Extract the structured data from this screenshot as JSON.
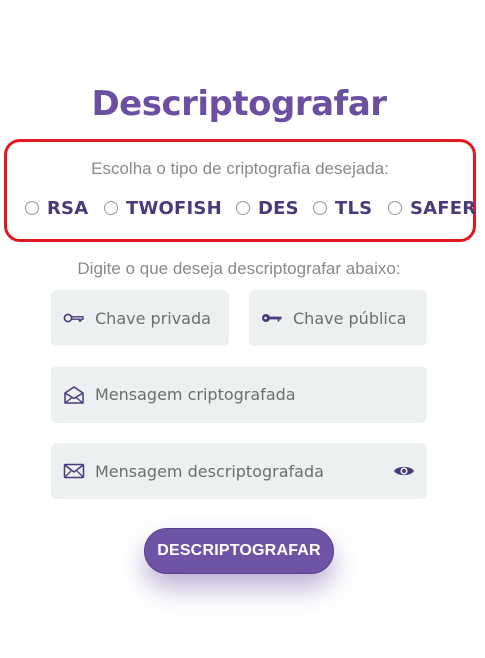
{
  "page": {
    "title": "Descriptografar",
    "choice_prompt": "Escolha o tipo de criptografia desejada:",
    "subtitle": "Digite o que deseja descriptografar abaixo:"
  },
  "algorithms": [
    {
      "label": "RSA",
      "selected": false
    },
    {
      "label": "TWOFISH",
      "selected": false
    },
    {
      "label": "DES",
      "selected": false
    },
    {
      "label": "TLS",
      "selected": false
    },
    {
      "label": "SAFER",
      "selected": false
    }
  ],
  "fields": {
    "private_key": {
      "placeholder": "Chave privada",
      "value": "",
      "icon": "key-outline-icon"
    },
    "public_key": {
      "placeholder": "Chave pública",
      "value": "",
      "icon": "key-solid-icon"
    },
    "encrypted_message": {
      "placeholder": "Mensagem criptografada",
      "value": "",
      "icon": "open-envelope-icon"
    },
    "decrypted_message": {
      "placeholder": "Mensagem descriptografada",
      "value": "",
      "icon": "envelope-icon",
      "trailing_icon": "eye-icon"
    }
  },
  "actions": {
    "submit_label": "DESCRIPTOGRAFAR"
  },
  "colors": {
    "accent": "#6b4fa0",
    "button": "#6f54a6",
    "highlight_border": "#e01822",
    "field_bg": "#edf0f1",
    "option_text": "#4a3a7a",
    "muted_text": "#8a8a8a"
  }
}
